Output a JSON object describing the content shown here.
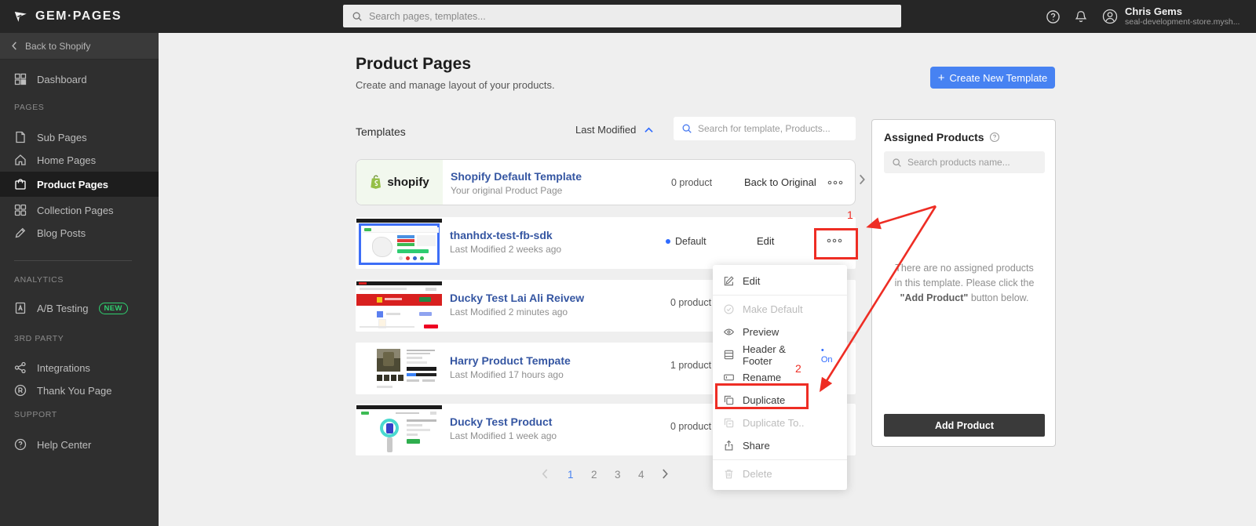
{
  "colors": {
    "accent_blue": "#4782f2",
    "link_blue": "#3556a2",
    "annotation_red": "#ee2d24",
    "badge_green": "#2fcf6f",
    "shopify_green": "#95bf47",
    "topbar_bg": "#262626",
    "sidebar_bg": "#2f2f2f"
  },
  "topbar": {
    "logo": "GEM·PAGES",
    "search_placeholder": "Search pages, templates...",
    "user_name": "Chris Gems",
    "user_store": "seal-development-store.mysh..."
  },
  "sidebar": {
    "back": "Back to Shopify",
    "dashboard": "Dashboard",
    "section_pages": "PAGES",
    "sub_pages": "Sub Pages",
    "home_pages": "Home Pages",
    "product_pages": "Product Pages",
    "collection_pages": "Collection Pages",
    "blog_posts": "Blog Posts",
    "section_analytics": "ANALYTICS",
    "ab_testing": "A/B Testing",
    "new_badge": "NEW",
    "section_3rd_party": "3RD PARTY",
    "integrations": "Integrations",
    "thank_you_page": "Thank You Page",
    "section_support": "SUPPORT",
    "help_center": "Help Center"
  },
  "page": {
    "title": "Product Pages",
    "subtitle": "Create and manage layout of your products.",
    "create_plus": "+",
    "create_button": "Create New Template"
  },
  "list": {
    "section_label": "Templates",
    "sort_label": "Last Modified",
    "search_placeholder": "Search for template, Products...",
    "shopify_row": {
      "brand": "shopify",
      "title": "Shopify Default Template",
      "subtitle": "Your original Product Page",
      "products": "0 product",
      "action": "Back to Original"
    },
    "rows": [
      {
        "title": "thanhdx-test-fb-sdk",
        "modified": "Last Modified 2 weeks ago",
        "badge": "Default",
        "action": "Edit"
      },
      {
        "title": "Ducky Test Lai Ali Reivew",
        "modified": "Last Modified 2 minutes ago",
        "products": "0 product"
      },
      {
        "title": "Harry Product Tempate",
        "modified": "Last Modified 17 hours ago",
        "products": "1 product"
      },
      {
        "title": "Ducky Test Product",
        "modified": "Last Modified 1 week ago",
        "products": "0 product"
      }
    ],
    "pagination": {
      "pages": [
        "1",
        "2",
        "3",
        "4"
      ],
      "current": "1"
    }
  },
  "context_menu": {
    "items": [
      {
        "label": "Edit"
      },
      {
        "label": "Make Default",
        "disabled": true
      },
      {
        "label": "Preview"
      },
      {
        "label": "Header & Footer",
        "badge": "• On"
      },
      {
        "label": "Rename"
      },
      {
        "label": "Duplicate"
      },
      {
        "label": "Duplicate To..",
        "disabled": true
      },
      {
        "label": "Share"
      },
      {
        "label": "Delete",
        "disabled": true
      }
    ]
  },
  "assigned_panel": {
    "title": "Assigned Products",
    "search_placeholder": "Search products name...",
    "empty_line_1": "There are no assigned products in this template. Please click the ",
    "empty_bold": "\"Add Product\"",
    "empty_line_2": " button below.",
    "add_button": "Add Product"
  },
  "annotations": {
    "step_1": "1",
    "step_2": "2"
  }
}
